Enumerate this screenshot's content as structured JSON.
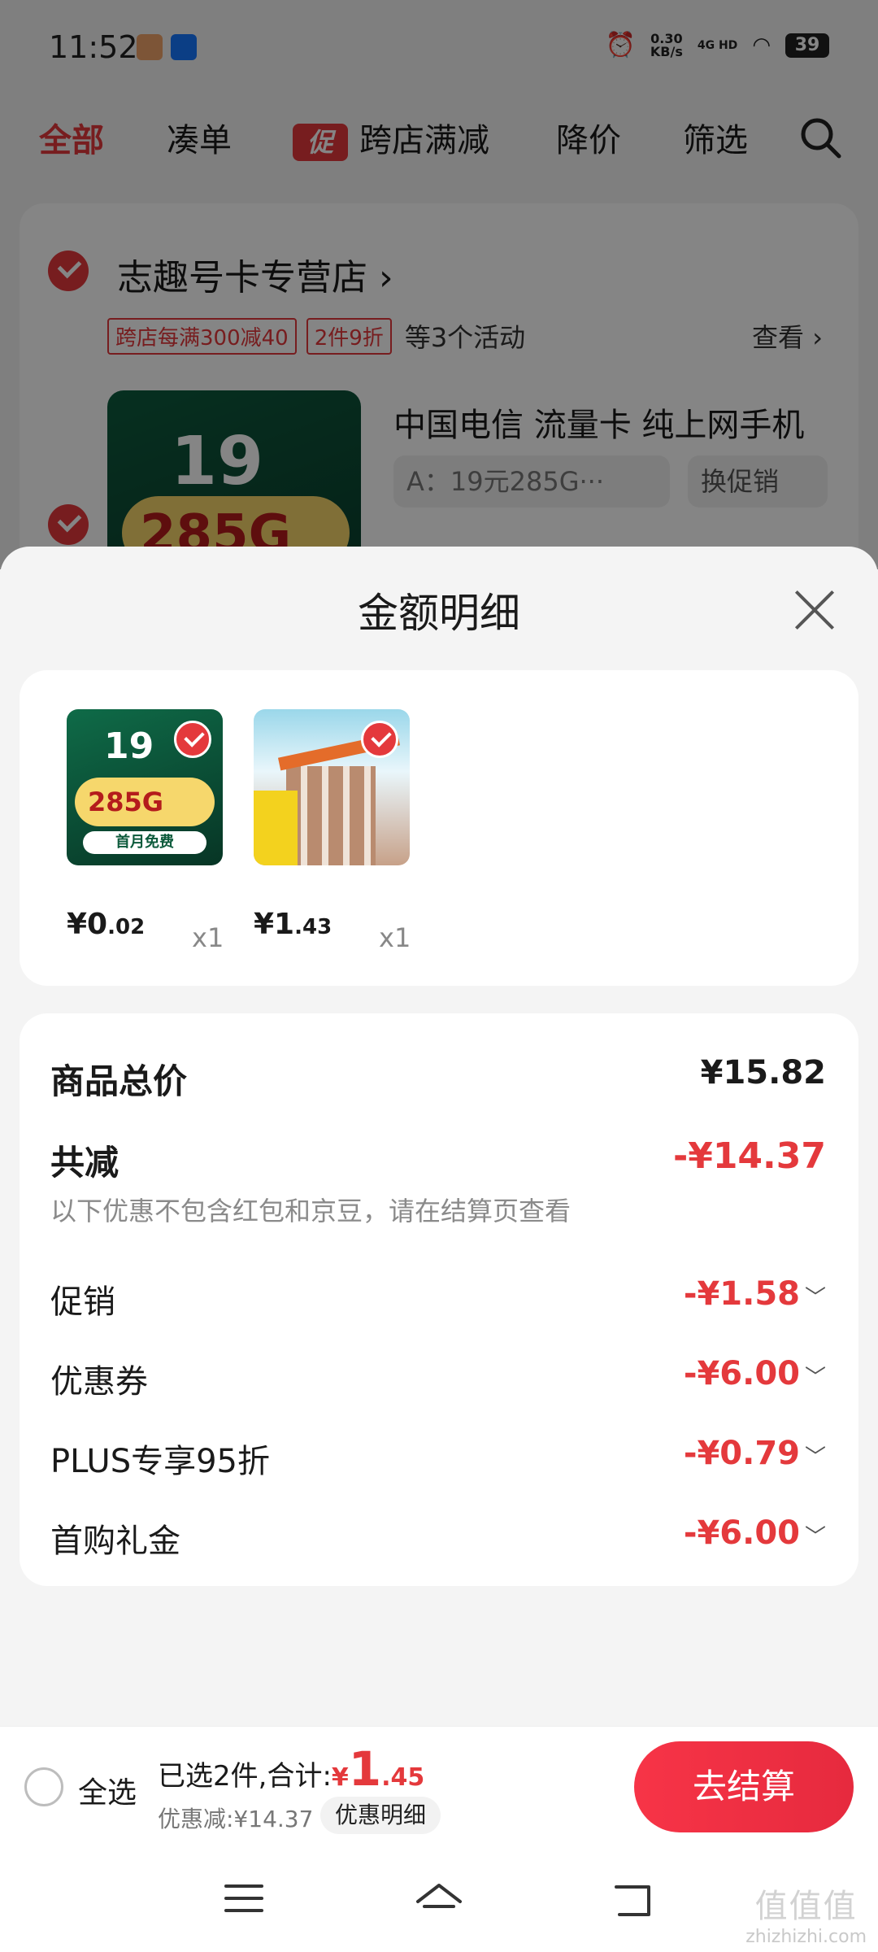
{
  "status_bar": {
    "time": "11:52",
    "speed_value": "0.30",
    "speed_unit": "KB/s",
    "network": "4G HD",
    "battery": "39"
  },
  "tabs": [
    {
      "label": "全部",
      "active": true
    },
    {
      "label": "凑单"
    },
    {
      "label": "跨店满减",
      "tag": "促"
    },
    {
      "label": "降价"
    },
    {
      "label": "筛选"
    }
  ],
  "store": {
    "name": "志趣号卡专营店",
    "chevron": "›",
    "tags": [
      "跨店每满300减40",
      "2件9折"
    ],
    "more": "等3个活动",
    "view": "查看 ›",
    "product_title": "中国电信 流量卡 纯上网手机",
    "variant": "A：19元285G···",
    "promo_switch": "换促销",
    "thumb_price": "19",
    "thumb_gb": "285G"
  },
  "sheet": {
    "title": "金额明细",
    "items": [
      {
        "name": "telecom-card",
        "price_int": "¥0",
        "price_dec": ".02",
        "qty": "x1",
        "img_text_19": "19",
        "img_text_gb": "285G",
        "img_text_free": "首月免费"
      },
      {
        "name": "window-cleaner",
        "price_int": "¥1",
        "price_dec": ".43",
        "qty": "x1"
      }
    ],
    "total_label": "商品总价",
    "total_value": "¥15.82",
    "discount_label": "共减",
    "discount_value": "-¥14.37",
    "discount_note": "以下优惠不包含红包和京豆，请在结算页查看",
    "details": [
      {
        "label": "促销",
        "value": "-¥1.58"
      },
      {
        "label": "优惠券",
        "value": "-¥6.00"
      },
      {
        "label": "PLUS专享95折",
        "value": "-¥0.79"
      },
      {
        "label": "首购礼金",
        "value": "-¥6.00"
      }
    ]
  },
  "checkout": {
    "select_all": "全选",
    "selected_text": "已选2件,合计:",
    "currency": "¥",
    "total_int": "1",
    "total_dec": ".45",
    "saving_text": "优惠减:¥14.37",
    "detail_chip": "优惠明细",
    "button": "去结算"
  },
  "watermark": {
    "main": "值值值",
    "sub": "zhizhizhi.com"
  },
  "colors": {
    "accent": "#e4393c",
    "green": "#0d5b3e"
  }
}
